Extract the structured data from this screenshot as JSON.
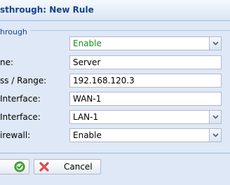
{
  "dialog": {
    "title": "sthrough: New Rule"
  },
  "fieldset": {
    "legend": "hrough"
  },
  "rows": [
    {
      "label": "",
      "value": "Enable",
      "type": "select"
    },
    {
      "label": "ne:",
      "value": "Server",
      "type": "text"
    },
    {
      "label": "ss / Range:",
      "value": "192.168.120.3",
      "type": "text"
    },
    {
      "label": "Interface:",
      "value": "WAN-1",
      "type": "text"
    },
    {
      "label": "Interface:",
      "value": "LAN-1",
      "type": "select"
    },
    {
      "label": "irewall:",
      "value": "Enable",
      "type": "select"
    }
  ],
  "buttons": {
    "cancel": "Cancel"
  },
  "colors": {
    "enabled_text": "#1a8a1a",
    "title_text": "#15428b",
    "panel_bg": "#dfe8f6"
  },
  "icons": {
    "ok": "check-circle-icon",
    "cancel": "red-x-icon",
    "dropdown": "chevron-down-icon"
  }
}
